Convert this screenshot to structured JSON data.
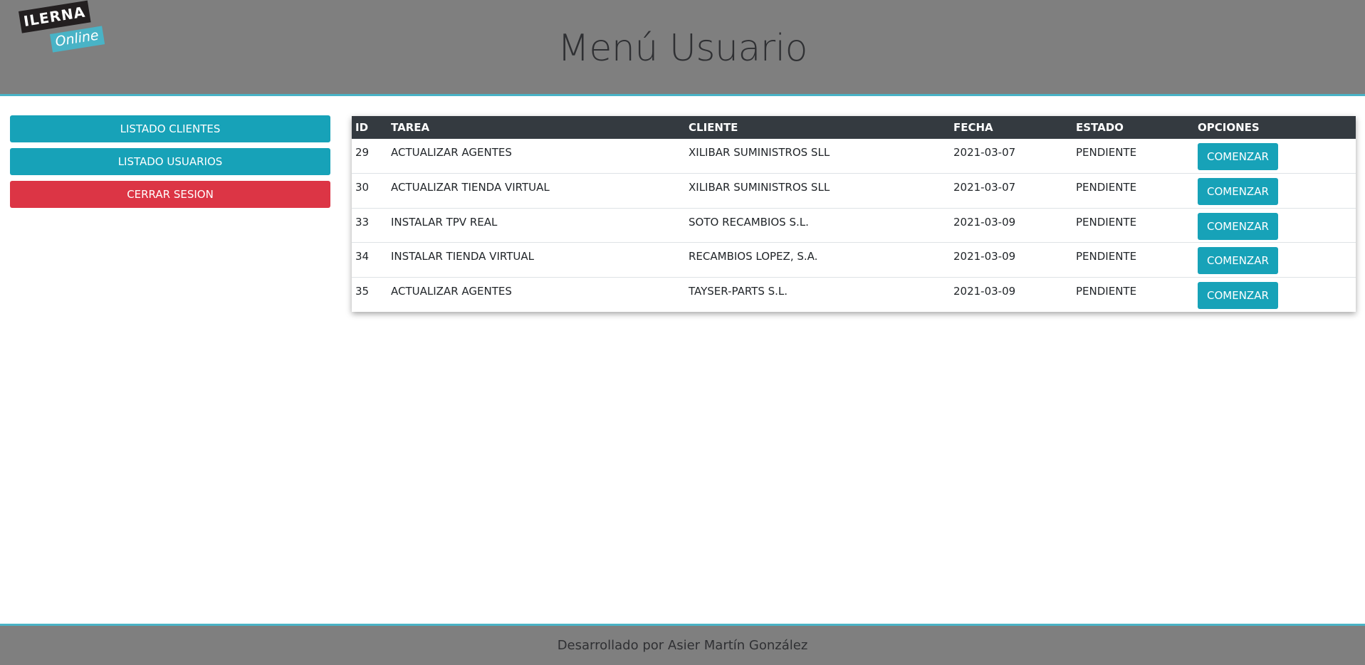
{
  "logo": {
    "top": "ILERNA",
    "bottom": "Online"
  },
  "header": {
    "title": "Menú Usuario"
  },
  "sidebar": {
    "buttons": [
      {
        "label": "LISTADO CLIENTES"
      },
      {
        "label": "LISTADO USUARIOS"
      },
      {
        "label": "CERRAR SESION"
      }
    ]
  },
  "table": {
    "headers": [
      "ID",
      "TAREA",
      "CLIENTE",
      "FECHA",
      "ESTADO",
      "OPCIONES"
    ],
    "rows": [
      {
        "id": "29",
        "tarea": "ACTUALIZAR AGENTES",
        "cliente": "XILIBAR SUMINISTROS SLL",
        "fecha": "2021-03-07",
        "estado": "PENDIENTE",
        "action": "COMENZAR"
      },
      {
        "id": "30",
        "tarea": "ACTUALIZAR TIENDA VIRTUAL",
        "cliente": "XILIBAR SUMINISTROS SLL",
        "fecha": "2021-03-07",
        "estado": "PENDIENTE",
        "action": "COMENZAR"
      },
      {
        "id": "33",
        "tarea": "INSTALAR TPV REAL",
        "cliente": "SOTO RECAMBIOS S.L.",
        "fecha": "2021-03-09",
        "estado": "PENDIENTE",
        "action": "COMENZAR"
      },
      {
        "id": "34",
        "tarea": "INSTALAR TIENDA VIRTUAL",
        "cliente": "RECAMBIOS LOPEZ, S.A.",
        "fecha": "2021-03-09",
        "estado": "PENDIENTE",
        "action": "COMENZAR"
      },
      {
        "id": "35",
        "tarea": "ACTUALIZAR AGENTES",
        "cliente": "TAYSER-PARTS S.L.",
        "fecha": "2021-03-09",
        "estado": "PENDIENTE",
        "action": "COMENZAR"
      }
    ]
  },
  "footer": {
    "text": "Desarrollado por Asier Martín González"
  },
  "colors": {
    "header_bg": "#7f7f7f",
    "accent": "#49b3c6",
    "info": "#17a2b8",
    "danger": "#dc3545",
    "table_head": "#343a40"
  }
}
